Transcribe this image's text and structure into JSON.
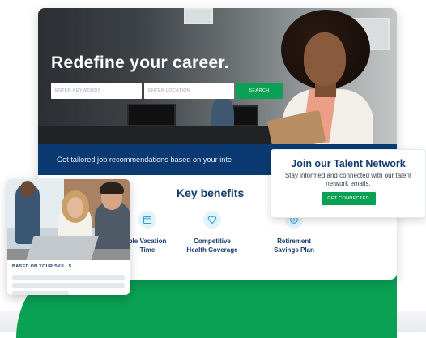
{
  "hero": {
    "title": "Redefine your career.",
    "keywords_placeholder": "ENTER KEYWORDS",
    "location_placeholder": "ENTER LOCATION",
    "search_label": "SEARCH"
  },
  "recommendation_bar": {
    "text": "Get tailored job recommendations based on your inte"
  },
  "benefits": {
    "title": "Key benefits",
    "items": [
      {
        "label": "ble Vacation\nTime",
        "icon": "calendar-icon"
      },
      {
        "label": "Competitive\nHealth Coverage",
        "icon": "health-icon"
      },
      {
        "label": "Retirement\nSavings Plan",
        "icon": "savings-icon"
      }
    ]
  },
  "talent_network": {
    "title": "Join our Talent Network",
    "text": "Stay informed and connected with our talent network emails.",
    "button_label": "GET CONNECTED"
  },
  "skills_card": {
    "label": "BASED ON YOUR SKILLS"
  },
  "colors": {
    "accent_green": "#0aa154",
    "navy": "#0b3a72",
    "heading_blue": "#143a6e"
  }
}
